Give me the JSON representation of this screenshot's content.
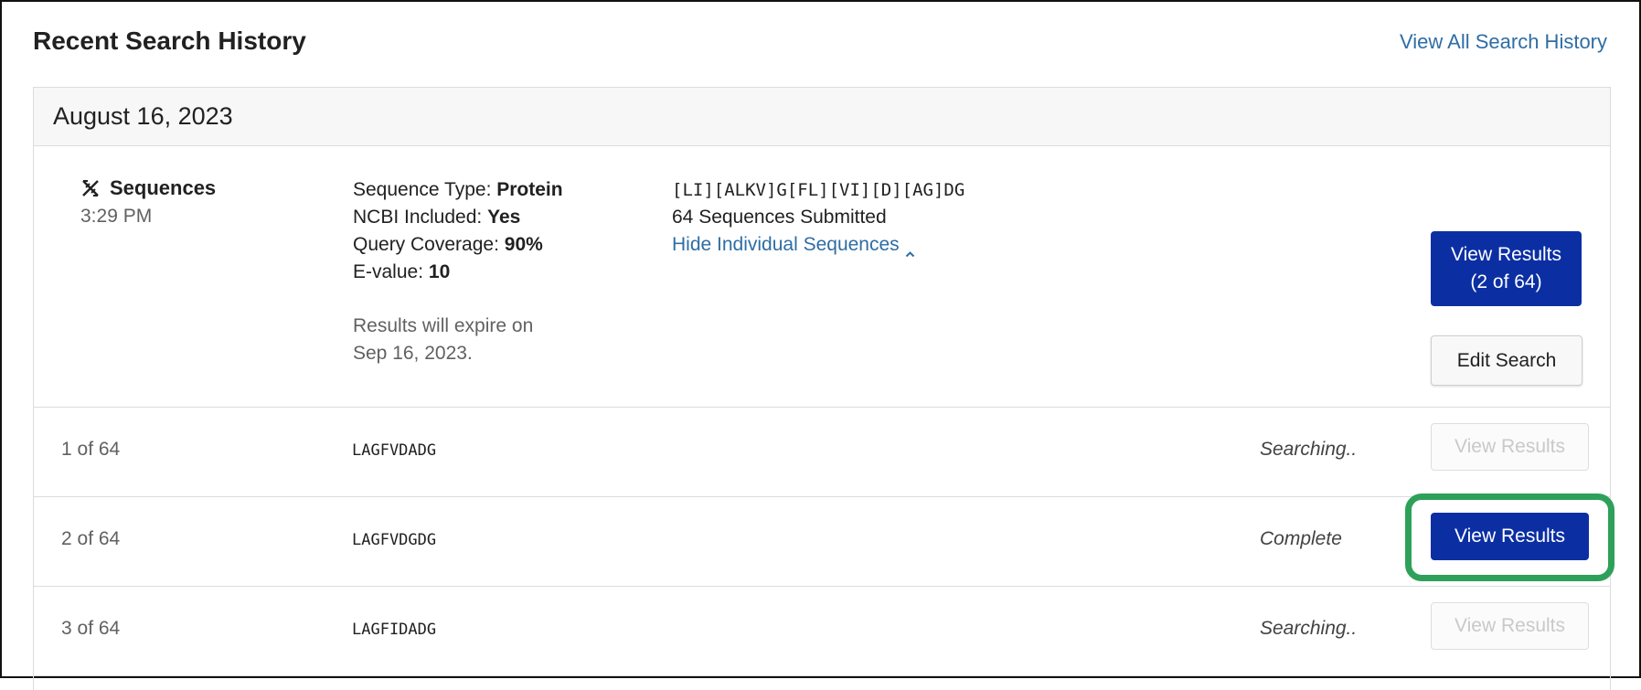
{
  "page": {
    "title": "Recent Search History",
    "view_all_label": "View All Search History"
  },
  "card": {
    "date": "August 16, 2023",
    "summary": {
      "type_label": "Sequences",
      "icon": "dna-icon",
      "time": "3:29 PM",
      "params": {
        "sequence_type_label": "Sequence Type:",
        "sequence_type_value": "Protein",
        "ncbi_label": "NCBI Included:",
        "ncbi_value": "Yes",
        "coverage_label": "Query Coverage:",
        "coverage_value": "90%",
        "evalue_label": "E-value:",
        "evalue_value": "10"
      },
      "expire_line1": "Results will expire on",
      "expire_line2": "Sep 16, 2023.",
      "pattern": "[LI][ALKV]G[FL][VI][D][AG]DG",
      "submitted": "64 Sequences Submitted",
      "hide_link": "Hide Individual Sequences",
      "view_results_line1": "View Results",
      "view_results_line2": "(2 of 64)",
      "edit_label": "Edit Search"
    },
    "rows": [
      {
        "index": "1 of 64",
        "sequence": "LAGFVDADG",
        "status": "Searching..",
        "button": "View Results",
        "enabled": false
      },
      {
        "index": "2 of 64",
        "sequence": "LAGFVDGDG",
        "status": "Complete",
        "button": "View Results",
        "enabled": true
      },
      {
        "index": "3 of 64",
        "sequence": "LAGFIDADG",
        "status": "Searching..",
        "button": "View Results",
        "enabled": false
      }
    ]
  },
  "colors": {
    "primary_button": "#0b2fa3",
    "link": "#2e6da4",
    "highlight": "#2ea05a"
  }
}
